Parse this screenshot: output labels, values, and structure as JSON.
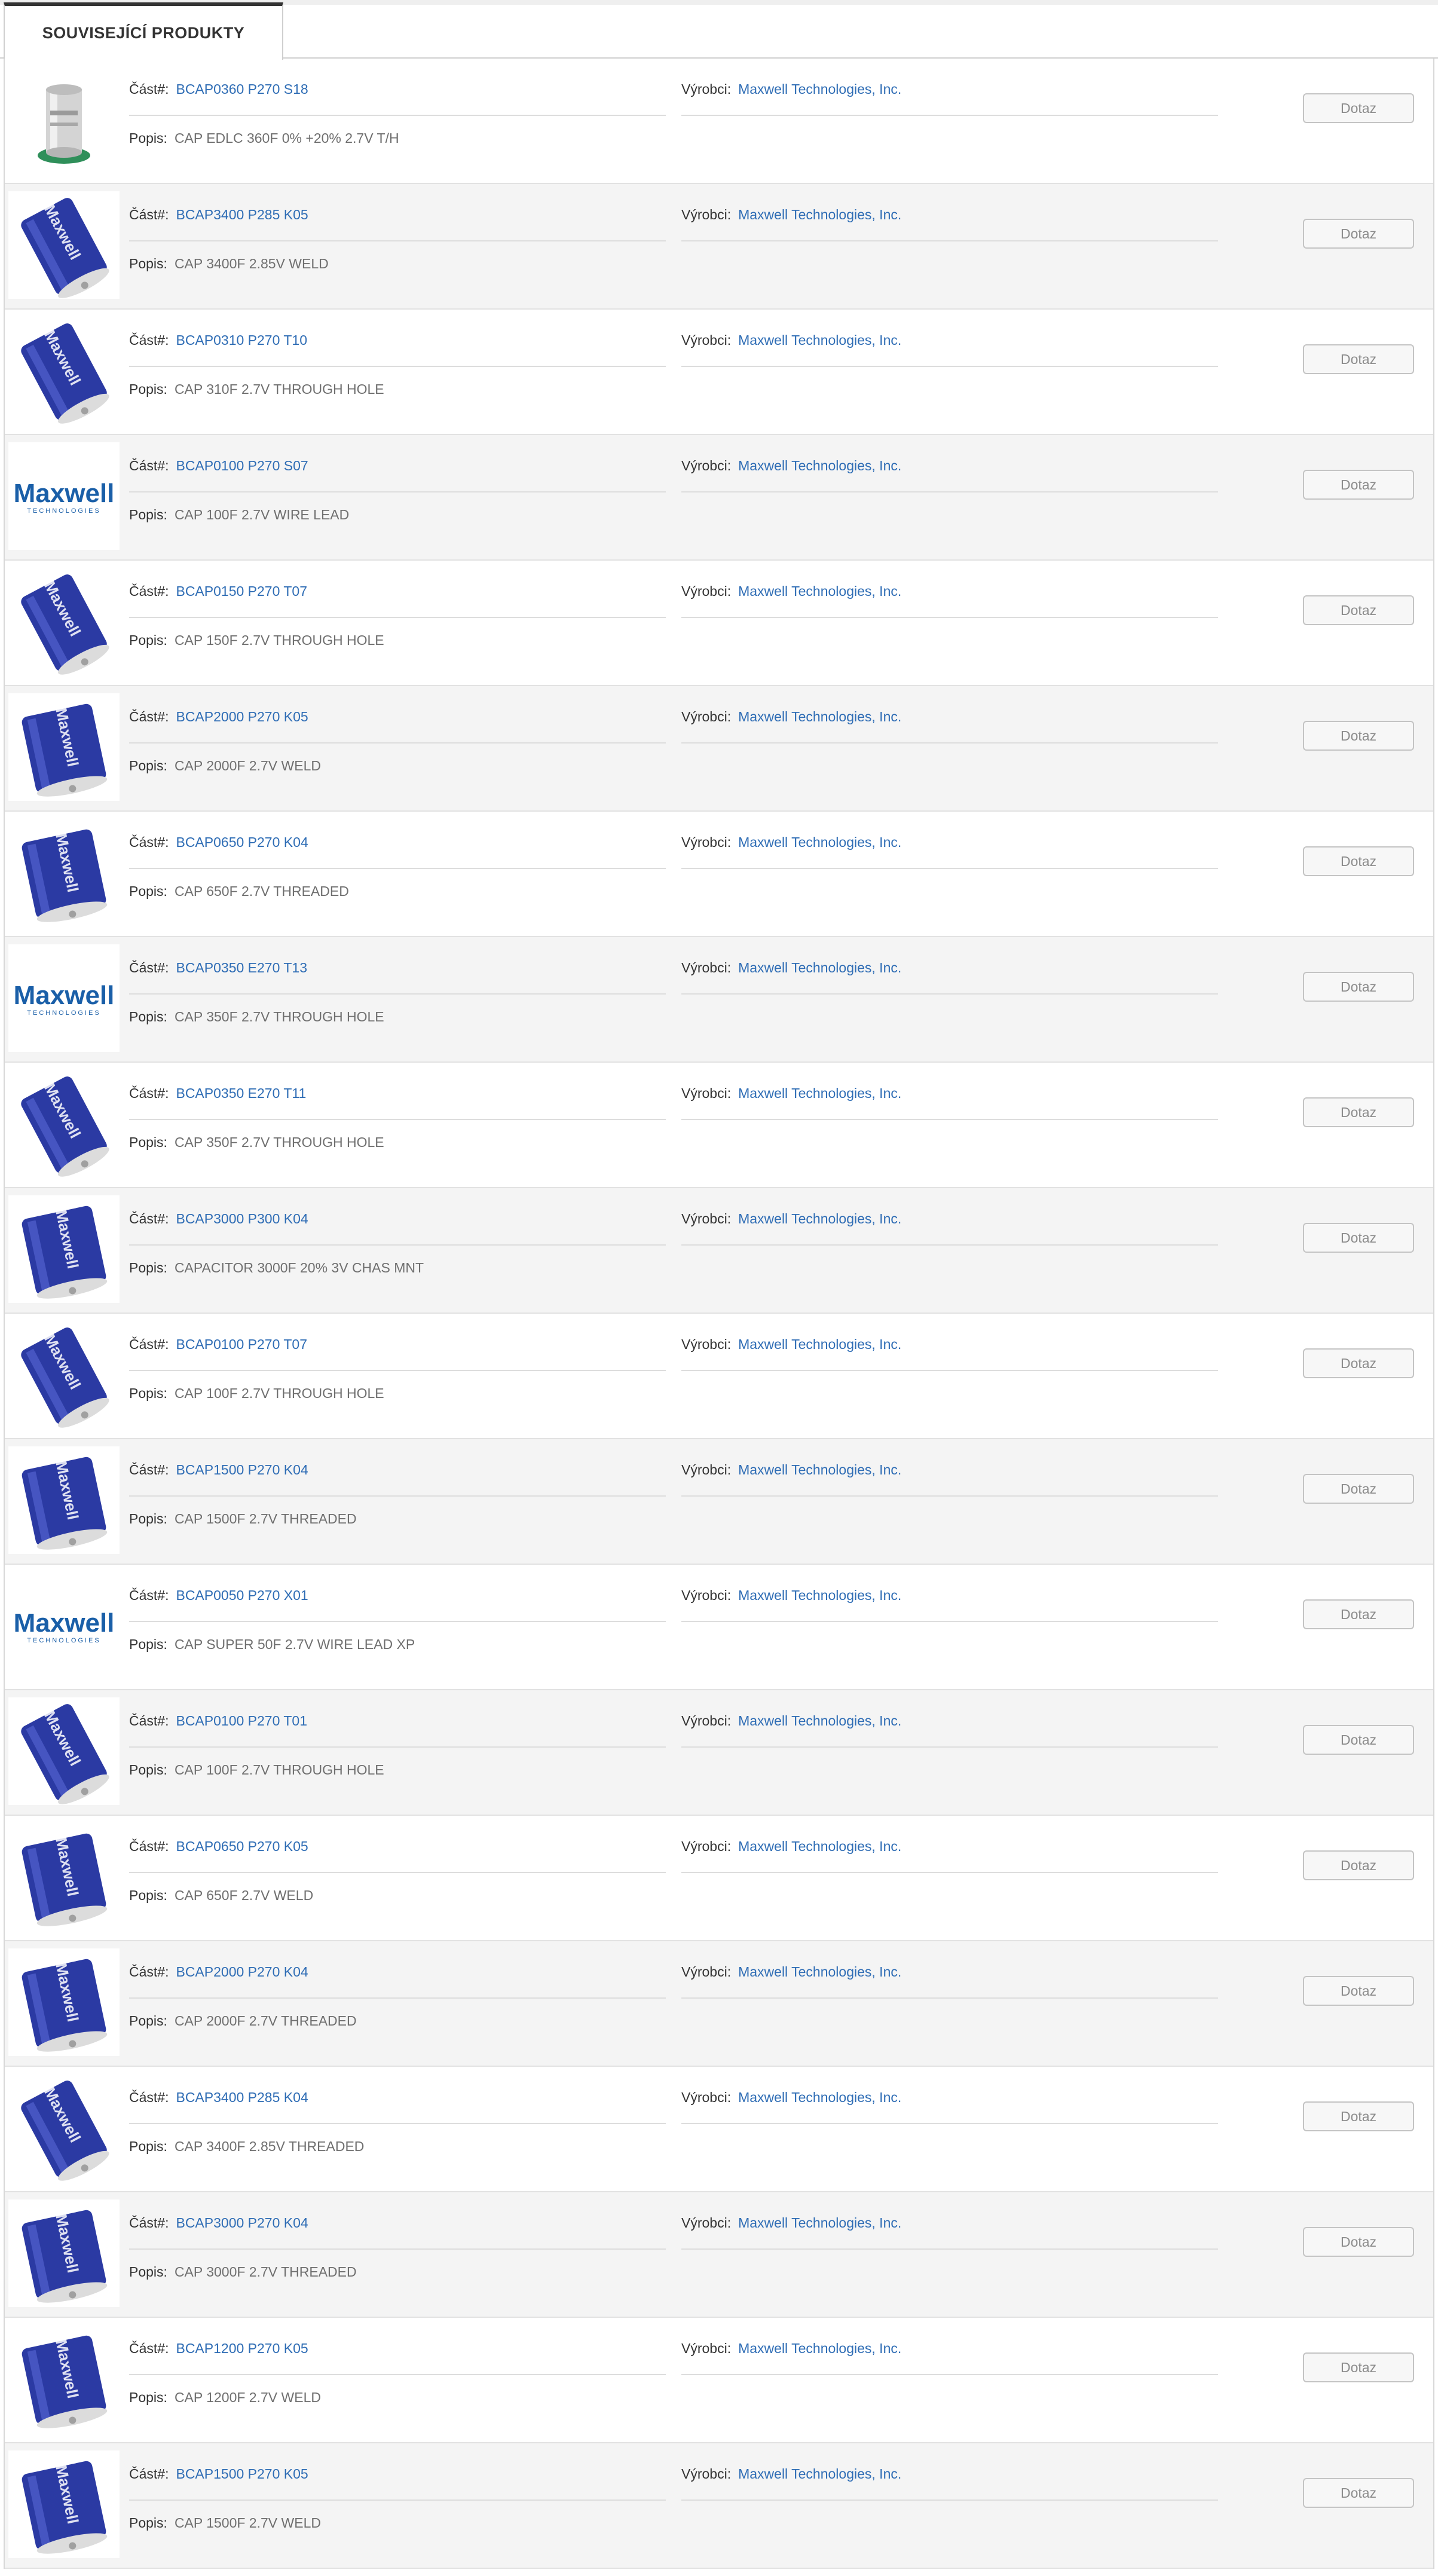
{
  "tab": {
    "label": "SOUVISEJÍCÍ PRODUKTY"
  },
  "labels": {
    "part": "Část#:",
    "manufacturer": "Výrobci:",
    "description": "Popis:",
    "button": "Dotaz"
  },
  "colors": {
    "link": "#2f6db5",
    "maxwell_blue": "#2b3aa3",
    "logo_blue": "#1a5fa8"
  },
  "products": [
    {
      "part": "BCAP0360 P270 S18",
      "manufacturer": "Maxwell Technologies, Inc.",
      "description": "CAP EDLC 360F 0% +20% 2.7V T/H",
      "image": "silver-cell"
    },
    {
      "part": "BCAP3400 P285 K05",
      "manufacturer": "Maxwell Technologies, Inc.",
      "description": "CAP 3400F 2.85V WELD",
      "image": "blue-cell-tilted"
    },
    {
      "part": "BCAP0310 P270 T10",
      "manufacturer": "Maxwell Technologies, Inc.",
      "description": "CAP 310F 2.7V THROUGH HOLE",
      "image": "blue-cell-tilted"
    },
    {
      "part": "BCAP0100 P270 S07",
      "manufacturer": "Maxwell Technologies, Inc.",
      "description": "CAP 100F 2.7V WIRE LEAD",
      "image": "maxwell-logo",
      "logo_text": "Maxwell",
      "logo_subtext": "TECHNOLOGIES"
    },
    {
      "part": "BCAP0150 P270 T07",
      "manufacturer": "Maxwell Technologies, Inc.",
      "description": "CAP 150F 2.7V THROUGH HOLE",
      "image": "blue-cell-tilted"
    },
    {
      "part": "BCAP2000 P270 K05",
      "manufacturer": "Maxwell Technologies, Inc.",
      "description": "CAP 2000F 2.7V WELD",
      "image": "blue-cell-large"
    },
    {
      "part": "BCAP0650 P270 K04",
      "manufacturer": "Maxwell Technologies, Inc.",
      "description": "CAP 650F 2.7V THREADED",
      "image": "blue-cell-large"
    },
    {
      "part": "BCAP0350 E270 T13",
      "manufacturer": "Maxwell Technologies, Inc.",
      "description": "CAP 350F 2.7V THROUGH HOLE",
      "image": "maxwell-logo",
      "logo_text": "Maxwell",
      "logo_subtext": "TECHNOLOGIES"
    },
    {
      "part": "BCAP0350 E270 T11",
      "manufacturer": "Maxwell Technologies, Inc.",
      "description": "CAP 350F 2.7V THROUGH HOLE",
      "image": "blue-cell-tilted"
    },
    {
      "part": "BCAP3000 P300 K04",
      "manufacturer": "Maxwell Technologies, Inc.",
      "description": "CAPACITOR 3000F 20% 3V CHAS MNT",
      "image": "blue-cell-large"
    },
    {
      "part": "BCAP0100 P270 T07",
      "manufacturer": "Maxwell Technologies, Inc.",
      "description": "CAP 100F 2.7V THROUGH HOLE",
      "image": "blue-cell-tilted"
    },
    {
      "part": "BCAP1500 P270 K04",
      "manufacturer": "Maxwell Technologies, Inc.",
      "description": "CAP 1500F 2.7V THREADED",
      "image": "blue-cell-large"
    },
    {
      "part": "BCAP0050 P270 X01",
      "manufacturer": "Maxwell Technologies, Inc.",
      "description": "CAP SUPER 50F 2.7V WIRE LEAD XP",
      "image": "maxwell-logo",
      "logo_text": "Maxwell",
      "logo_subtext": "TECHNOLOGIES"
    },
    {
      "part": "BCAP0100 P270 T01",
      "manufacturer": "Maxwell Technologies, Inc.",
      "description": "CAP 100F 2.7V THROUGH HOLE",
      "image": "blue-cell-tilted"
    },
    {
      "part": "BCAP0650 P270 K05",
      "manufacturer": "Maxwell Technologies, Inc.",
      "description": "CAP 650F 2.7V WELD",
      "image": "blue-cell-large"
    },
    {
      "part": "BCAP2000 P270 K04",
      "manufacturer": "Maxwell Technologies, Inc.",
      "description": "CAP 2000F 2.7V THREADED",
      "image": "blue-cell-large"
    },
    {
      "part": "BCAP3400 P285 K04",
      "manufacturer": "Maxwell Technologies, Inc.",
      "description": "CAP 3400F 2.85V THREADED",
      "image": "blue-cell-tilted"
    },
    {
      "part": "BCAP3000 P270 K04",
      "manufacturer": "Maxwell Technologies, Inc.",
      "description": "CAP 3000F 2.7V THREADED",
      "image": "blue-cell-large"
    },
    {
      "part": "BCAP1200 P270 K05",
      "manufacturer": "Maxwell Technologies, Inc.",
      "description": "CAP 1200F 2.7V WELD",
      "image": "blue-cell-large"
    },
    {
      "part": "BCAP1500 P270 K05",
      "manufacturer": "Maxwell Technologies, Inc.",
      "description": "CAP 1500F 2.7V WELD",
      "image": "blue-cell-large"
    }
  ]
}
